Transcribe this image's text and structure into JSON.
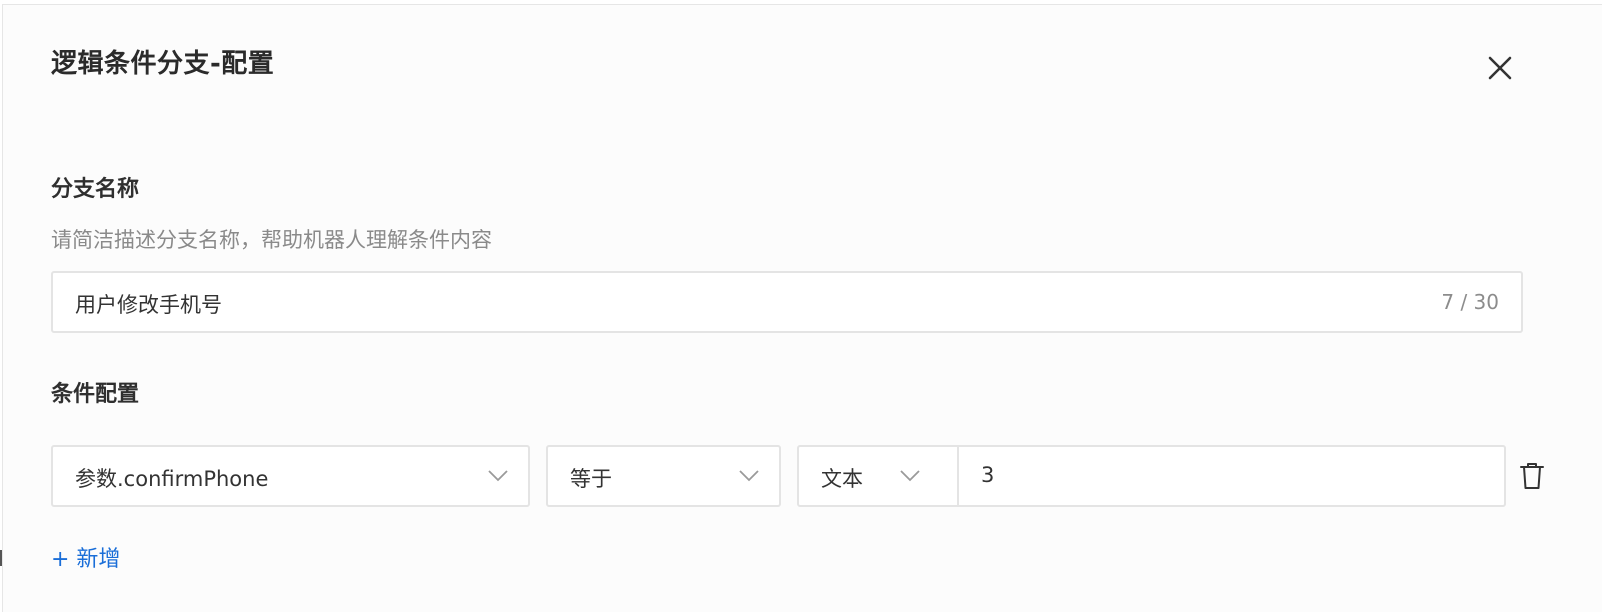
{
  "dialog": {
    "title": "逻辑条件分支-配置"
  },
  "branch_name": {
    "label": "分支名称",
    "hint": "请简洁描述分支名称，帮助机器人理解条件内容",
    "value": "用户修改手机号",
    "counter": "7 / 30"
  },
  "condition": {
    "label": "条件配置",
    "row": {
      "param": "参数.confirmPhone",
      "operator": "等于",
      "value_type": "文本",
      "value": "3"
    },
    "add_label": "+ 新增"
  },
  "icons": {
    "close": "close-icon",
    "chevron": "chevron-down-icon",
    "delete": "trash-icon"
  },
  "colors": {
    "accent": "#1a6ed8",
    "border": "#e4e4e4",
    "hint_text": "#8a8a8a"
  }
}
